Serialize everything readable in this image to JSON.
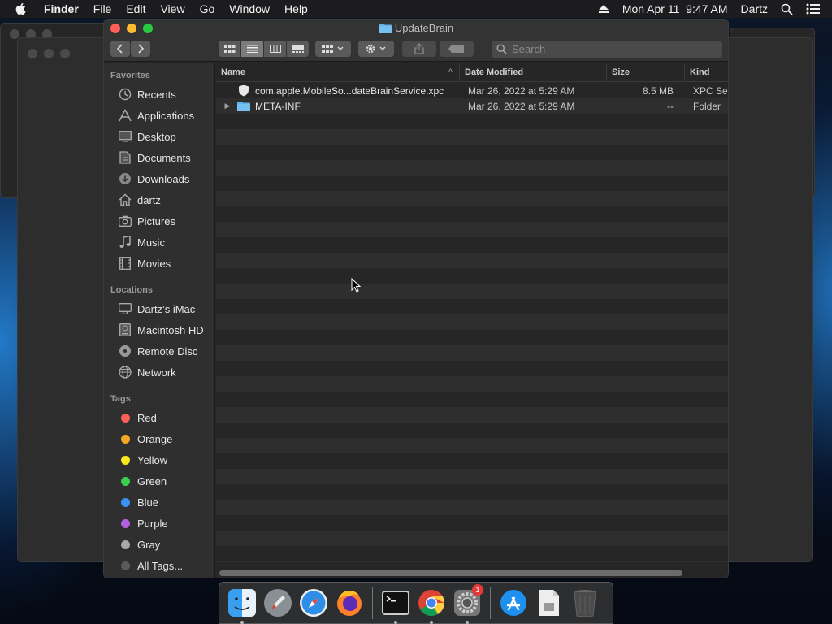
{
  "menubar": {
    "app_name": "Finder",
    "items": [
      "File",
      "Edit",
      "View",
      "Go",
      "Window",
      "Help"
    ],
    "datetime": "Mon Apr 11  9:47 AM",
    "user": "Dartz"
  },
  "window": {
    "title": "UpdateBrain",
    "search_placeholder": "Search"
  },
  "sidebar": {
    "favorites_header": "Favorites",
    "favorites": [
      {
        "label": "Recents",
        "icon": "clock-icon"
      },
      {
        "label": "Applications",
        "icon": "applications-icon"
      },
      {
        "label": "Desktop",
        "icon": "desktop-icon"
      },
      {
        "label": "Documents",
        "icon": "document-icon"
      },
      {
        "label": "Downloads",
        "icon": "download-icon"
      },
      {
        "label": "dartz",
        "icon": "home-icon"
      },
      {
        "label": "Pictures",
        "icon": "camera-icon"
      },
      {
        "label": "Music",
        "icon": "music-icon"
      },
      {
        "label": "Movies",
        "icon": "film-icon"
      }
    ],
    "locations_header": "Locations",
    "locations": [
      {
        "label": "Dartz’s iMac",
        "icon": "computer-icon"
      },
      {
        "label": "Macintosh HD",
        "icon": "disk-icon"
      },
      {
        "label": "Remote Disc",
        "icon": "disc-icon"
      },
      {
        "label": "Network",
        "icon": "network-icon"
      }
    ],
    "tags_header": "Tags",
    "tags": [
      {
        "label": "Red",
        "color": "#fe5f57"
      },
      {
        "label": "Orange",
        "color": "#f5a623"
      },
      {
        "label": "Yellow",
        "color": "#f8e71c"
      },
      {
        "label": "Green",
        "color": "#3ecf4a"
      },
      {
        "label": "Blue",
        "color": "#3b8ff5"
      },
      {
        "label": "Purple",
        "color": "#b45fe0"
      },
      {
        "label": "Gray",
        "color": "#a8a8a8"
      },
      {
        "label": "All Tags...",
        "color": "#5a5a5a"
      }
    ]
  },
  "columns": {
    "name": "Name",
    "date": "Date Modified",
    "size": "Size",
    "kind": "Kind"
  },
  "files": [
    {
      "name": "com.apple.MobileSo...dateBrainService.xpc",
      "date": "Mar 26, 2022 at 5:29 AM",
      "size": "8.5 MB",
      "kind": "XPC Service",
      "icon": "xpc-icon",
      "expandable": false
    },
    {
      "name": "META-INF",
      "date": "Mar 26, 2022 at 5:29 AM",
      "size": "--",
      "kind": "Folder",
      "icon": "folder-icon",
      "expandable": true
    }
  ],
  "dock": {
    "apps": [
      "finder-icon",
      "launchpad-icon",
      "safari-icon",
      "firefox-icon",
      "terminal-icon",
      "chrome-icon",
      "system-preferences-icon",
      "app-store-icon",
      "file-icon",
      "trash-icon"
    ],
    "prefs_badge": "1"
  }
}
